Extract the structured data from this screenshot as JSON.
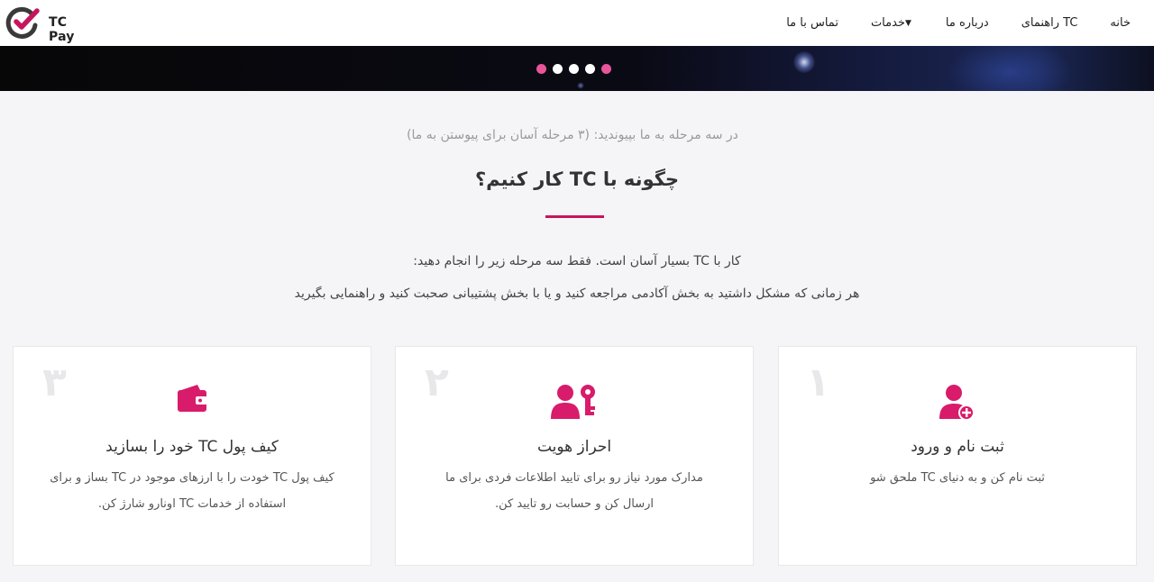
{
  "brand": {
    "name": "TC Pay",
    "accent": "#c8145f"
  },
  "nav": {
    "items": [
      {
        "label": "خانه"
      },
      {
        "label": "راهنمای TC"
      },
      {
        "label": "درباره ما"
      },
      {
        "label": "خدمات",
        "dropdown": true
      },
      {
        "label": "تماس با ما"
      }
    ]
  },
  "slider": {
    "dot_count": 5,
    "active_color": "#e8559a"
  },
  "intro": {
    "subtitle": "در سه مرحله به ما بپیوندید: (۳ مرحله آسان برای پیوستن به ما)",
    "title": "چگونه با TC کار کنیم؟",
    "line1": "کار با TC بسیار آسان است. فقط سه مرحله زیر را انجام دهید:",
    "line2": "هر زمانی که مشکل داشتید به بخش آکادمی مراجعه کنید و یا با بخش پشتیبانی صحبت کنید و راهنمایی بگیرید"
  },
  "steps": [
    {
      "number": "۱",
      "icon": "user-plus-icon",
      "title": "ثبت نام و ورود",
      "text": "ثبت نام کن و به دنیای TC ملحق شو"
    },
    {
      "number": "۲",
      "icon": "user-key-icon",
      "title": "احراز هویت",
      "text": "مدارک مورد نیاز رو برای تایید اطلاعات فردی برای ما ارسال کن و حسابت رو تایید کن."
    },
    {
      "number": "۳",
      "icon": "wallet-icon",
      "title": "کیف پول TC خود را بسازید",
      "text": "کیف پول TC خودت را با ارزهای موجود در TC بساز و برای استفاده از خدمات TC اونارو شارژ کن."
    }
  ]
}
